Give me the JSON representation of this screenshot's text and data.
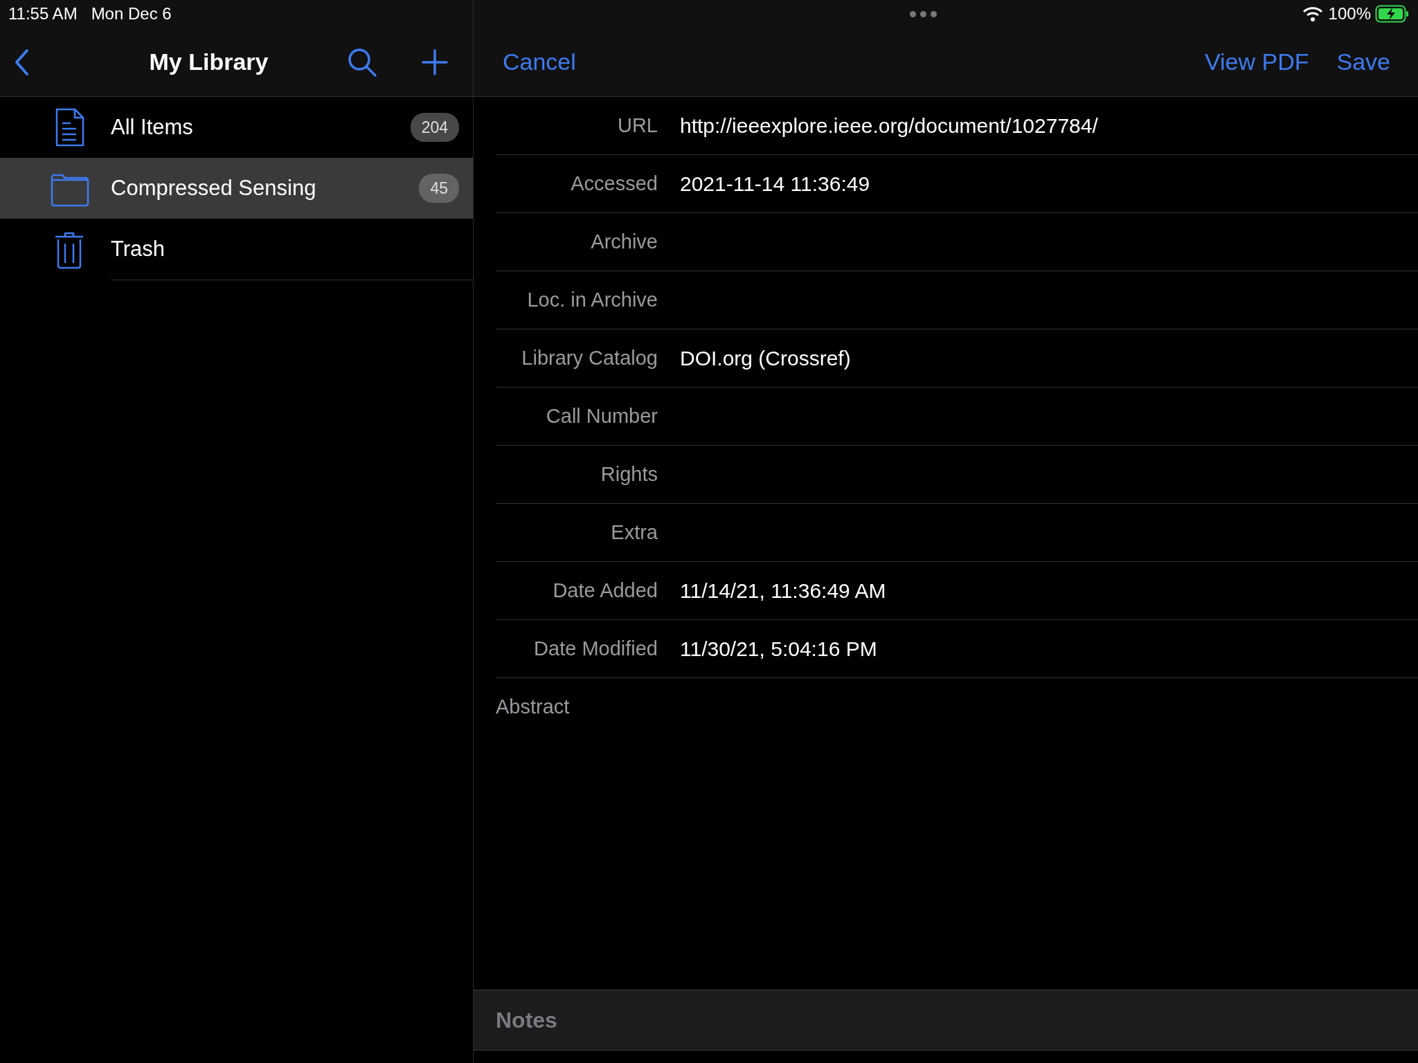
{
  "status_bar": {
    "time": "11:55 AM",
    "date": "Mon Dec 6",
    "battery": "100%"
  },
  "sidebar": {
    "title": "My Library",
    "items": [
      {
        "kind": "document",
        "label": "All Items",
        "count": "204",
        "selected": false
      },
      {
        "kind": "folder",
        "label": "Compressed Sensing",
        "count": "45",
        "selected": true
      },
      {
        "kind": "trash",
        "label": "Trash",
        "selected": false
      }
    ]
  },
  "toolbar": {
    "cancel": "Cancel",
    "view_pdf": "View PDF",
    "save": "Save"
  },
  "fields": [
    {
      "label": "URL",
      "value": "http://ieeexplore.ieee.org/document/1027784/"
    },
    {
      "label": "Accessed",
      "value": "2021-11-14 11:36:49"
    },
    {
      "label": "Archive"
    },
    {
      "label": "Loc. in Archive"
    },
    {
      "label": "Library Catalog",
      "value": "DOI.org (Crossref)"
    },
    {
      "label": "Call Number"
    },
    {
      "label": "Rights"
    },
    {
      "label": "Extra"
    },
    {
      "label": "Date Added",
      "value": "11/14/21, 11:36:49 AM"
    },
    {
      "label": "Date Modified",
      "value": "11/30/21, 5:04:16 PM"
    }
  ],
  "abstract_label": "Abstract",
  "notes_label": "Notes"
}
